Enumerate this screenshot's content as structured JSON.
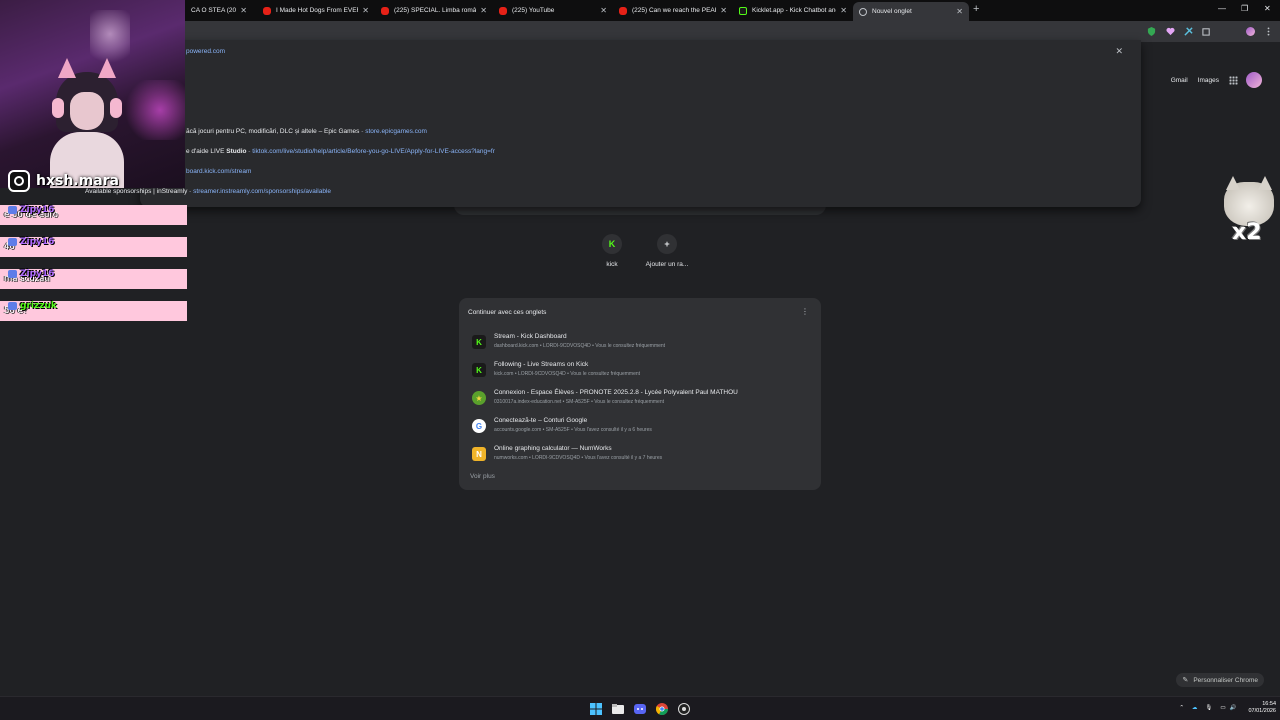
{
  "tabs": [
    {
      "title": "CA O STEA (2009",
      "favicon": "youtube"
    },
    {
      "title": "I Made Hot Dogs From EVERY",
      "favicon": "youtube"
    },
    {
      "title": "(225) SPECIAL. Limba română,",
      "favicon": "youtube"
    },
    {
      "title": "(225) YouTube",
      "favicon": "youtube"
    },
    {
      "title": "(225) Can we reach the PEAK w",
      "favicon": "youtube"
    },
    {
      "title": "Kicklet.app - Kick Chatbot and",
      "favicon": "kick"
    },
    {
      "title": "Nouvel onglet",
      "favicon": "globe",
      "active": true
    }
  ],
  "omnibox_dropdown": {
    "top_url": "powered.com",
    "suggestions": [
      {
        "text": "ăcă jocuri pentru PC, modificări, DLC și altele – Epic Games",
        "separator": " - ",
        "url": "store.epicgames.com"
      },
      {
        "text_pre": "e d'aide LIVE ",
        "text_bold": "Studio",
        "separator": " - ",
        "url": "tiktok.com/live/studio/help/article/Before-you-go-LIVE/Apply-for-LIVE-access?lang=fr"
      },
      {
        "text": "",
        "separator": "",
        "url": "board.kick.com/stream"
      },
      {
        "text": "Available sponsorships | inStreamly",
        "separator": " - ",
        "url": "streamer.instreamly.com/sponsorships/available"
      }
    ]
  },
  "overlay": {
    "handle": "hxsh.mara",
    "chat": [
      {
        "user": "Zipy16",
        "message": "e 50 de euro",
        "color": "#b06bff"
      },
      {
        "user": "Zipy16",
        "message": "40",
        "color": "#b06bff"
      },
      {
        "user": "Zipy16",
        "message": "ma scuzati",
        "color": "#b06bff"
      },
      {
        "user": "grizzuk",
        "message": "50 e?",
        "color": "#53fc18"
      }
    ],
    "cat_label": "x2"
  },
  "ntp": {
    "gmail": "Gmail",
    "images": "Images",
    "shortcuts": [
      {
        "label": "kick",
        "icon": "kick-icon",
        "glyph": "K"
      },
      {
        "label": "Ajouter un ra...",
        "icon": "plus-icon",
        "glyph": "+"
      }
    ],
    "continue_header": "Continuer avec ces onglets",
    "continue_items": [
      {
        "title": "Stream - Kick Dashboard",
        "sub": "dashboard.kick.com • LORDI-9CDVOSQ4D • Vous le consultez fréquemment",
        "icon": "kick-icon",
        "glyph": "K",
        "bg": "#1a1a1a",
        "fg": "#53fc18"
      },
      {
        "title": "Following - Live Streams on Kick",
        "sub": "kick.com • LORDI-9CDVOSQ4D • Vous le consultez fréquemment",
        "icon": "kick-icon",
        "glyph": "K",
        "bg": "#1a1a1a",
        "fg": "#53fc18"
      },
      {
        "title": "Connexion - Espace Élèves - PRONOTE 2025.2.8 - Lycée Polyvalent Paul MATHOU",
        "sub": "0310017a.index-education.net • SM-A525F • Vous le consultez fréquemment",
        "icon": "pronote-icon",
        "glyph": "★",
        "bg": "#5aa02c",
        "fg": "#f5d742"
      },
      {
        "title": "Conectează-te – Conturi Google",
        "sub": "accounts.google.com • SM-A525F • Vous l'avez consulté il y a 6 heures",
        "icon": "google-icon",
        "glyph": "G",
        "bg": "#ffffff",
        "fg": "#4285f4"
      },
      {
        "title": "Online graphing calculator — NumWorks",
        "sub": "numworks.com • LORDI-9CDVOSQ4D • Vous l'avez consulté il y a 7 heures",
        "icon": "numworks-icon",
        "glyph": "N",
        "bg": "#f0b429",
        "fg": "#ffffff"
      }
    ],
    "voir_plus": "Voir plus",
    "customize": "Personnaliser Chrome"
  },
  "taskbar": {
    "time": "16:54",
    "date": "07/01/2026"
  }
}
